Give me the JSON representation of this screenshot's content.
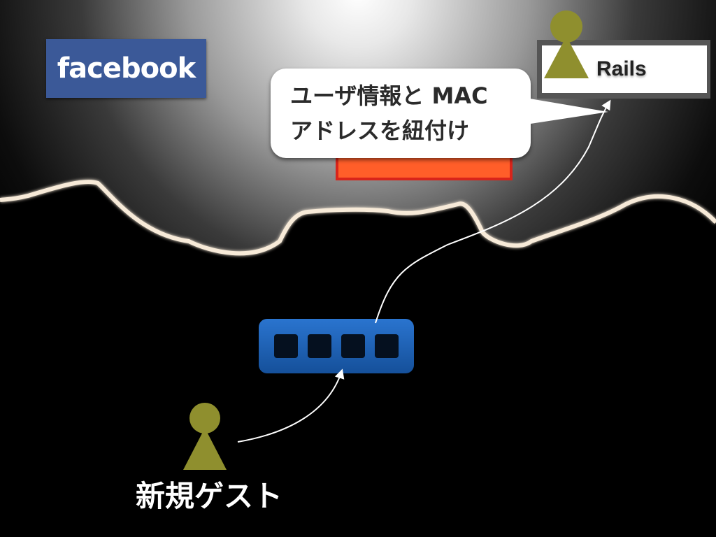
{
  "facebook": {
    "logo_text": "facebook"
  },
  "rails": {
    "label": "Rails"
  },
  "callout": {
    "line1": "ユーザ情報と MAC",
    "line2": "アドレスを紐付け"
  },
  "guest": {
    "label": "新規ゲスト"
  },
  "colors": {
    "facebook_blue": "#3b5998",
    "pawn_olive": "#8f8f2e",
    "router_blue": "#1e5fb0",
    "orange_fill": "#ff5e29",
    "orange_border": "#d8241a"
  },
  "icons": {
    "pawn": "person-pawn-icon",
    "router": "network-switch-icon",
    "cloud": "cloud-shape",
    "arrow": "curved-arrow"
  }
}
